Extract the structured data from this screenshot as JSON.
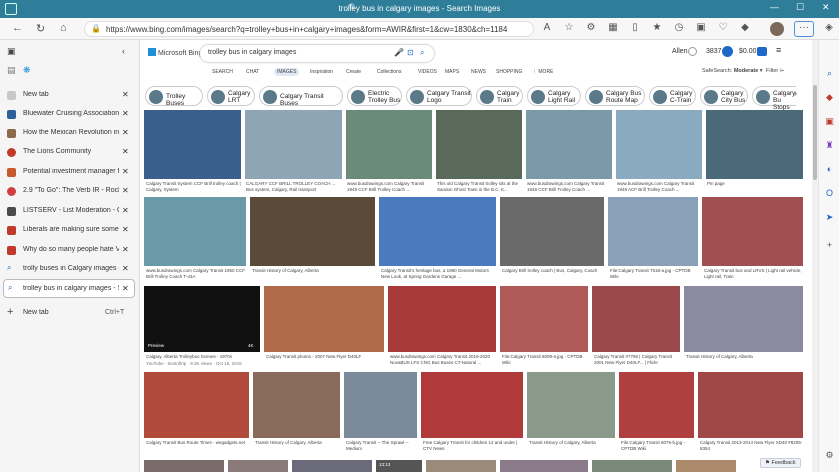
{
  "window": {
    "title": "trolley bus in calgary images - Search Images",
    "controls": [
      "—",
      "☐",
      "✕"
    ]
  },
  "browser": {
    "url": "https://www.bing.com/images/search?q=trolley+bus+in+calgary+images&form=AWIR&first=1&cw=1830&ch=1184",
    "toolbar_rewards_count": "3837",
    "toolbar_money": "$0.00"
  },
  "tabs_panel": {
    "tabs": [
      {
        "label": "New tab",
        "color": "#c8c8c8"
      },
      {
        "label": "Bluewater Cruising Association",
        "color": "#2f5f9a"
      },
      {
        "label": "How the Mexican Revolution inspired",
        "color": "#8a6a4a"
      },
      {
        "label": "The Lions Community",
        "color": "#c0392b"
      },
      {
        "label": "Potential investment manager for",
        "color": "#c75a2a"
      },
      {
        "label": "2.9 \"To Go\": The Verb IR - Rocket",
        "color": "#d04040"
      },
      {
        "label": "LISTSERV - List Moderation - CCI",
        "color": "#4a4a4a"
      },
      {
        "label": "Liberals are making sure some of",
        "color": "#c0392b"
      },
      {
        "label": "Why do so many people hate VAT",
        "color": "#c0392b"
      },
      {
        "label": "trolly buses in Calgary images - S",
        "color": "#1e68c8"
      },
      {
        "label": "trolley bus in calgary images - Se",
        "color": "#1e68c8"
      }
    ],
    "new_tab_label": "New tab",
    "new_tab_shortcut": "Ctrl+T"
  },
  "bing": {
    "logo_text": "Microsoft Bing",
    "query": "trolley bus in calgary images",
    "user_name": "Allen",
    "rewards": "3837",
    "money": "$0.00",
    "nav_tabs": [
      "SEARCH",
      "CHAT",
      "IMAGES",
      "Inspiration",
      "Create",
      "Collections",
      "VIDEOS",
      "MAPS",
      "NEWS",
      "SHOPPING",
      "⋮ MORE"
    ],
    "safesearch_label": "SafeSearch:",
    "safesearch_value": "Moderate",
    "filter_label": "Filter",
    "related_chips": [
      {
        "line1": "Trolley Buses",
        "line2": ""
      },
      {
        "line1": "Calgary",
        "line2": "LRT"
      },
      {
        "line1": "Calgary Transit Buses",
        "line2": ""
      },
      {
        "line1": "Electric",
        "line2": "Trolley Bus"
      },
      {
        "line1": "Calgary Transit",
        "line2": "Logo"
      },
      {
        "line1": "Calgary",
        "line2": "Train"
      },
      {
        "line1": "Calgary",
        "line2": "Light Rail"
      },
      {
        "line1": "Calgary Bus",
        "line2": "Route Map"
      },
      {
        "line1": "Calgary",
        "line2": "C-Train"
      },
      {
        "line1": "Calgary",
        "line2": "City Bus"
      },
      {
        "line1": "Calgary Bu",
        "line2": "Stops"
      }
    ],
    "results": [
      {
        "caption": "Calgary Transit System CCF Brill trolley coach | Calgary, System",
        "color": "#3a5f8c"
      },
      {
        "caption": "CALGARY CCF BRILL TROLLEY COACH ... Bus system, Calgary, Rail transport",
        "color": "#8ea5b5"
      },
      {
        "caption": "www.busdrawings.com Calgary Transit 1949 CCF Brill Trolley Coach ...",
        "color": "#6a8a7a"
      },
      {
        "caption": "This old Calgary Transit trolley sits at the Sandon Ghost Town in the B.C. K...",
        "color": "#5a6a5a"
      },
      {
        "caption": "www.busdrawings.com Calgary Transit 1948 CCF Brill Trolley Coach ...",
        "color": "#7a9aaa"
      },
      {
        "caption": "www.busdrawings.com Calgary Transit 1948 ACF Brill Trolley Coach ...",
        "color": "#8aaac0"
      },
      {
        "caption": "Pin page",
        "color": "#4a6a7a"
      },
      {
        "caption": "www.busdrawings.com Calgary Transit 1950 CCF Brill Trolley Coach T-43A",
        "color": "#6a9aa8"
      },
      {
        "caption": "Transit History of Calgary, Alberta",
        "color": "#5a4a3a"
      },
      {
        "caption": "Calgary Transit's heritage bus, a 1980 General Motors New Look, at Spring Gardens Garage ...",
        "color": "#4a7ac0"
      },
      {
        "caption": "Calgary Brill trolley coach | Bus, Calgary, Coach",
        "color": "#6a6a6a"
      },
      {
        "caption": "File:Calgary Transit 7518-a.jpg - CPTDB Wiki",
        "color": "#8aa0b8"
      },
      {
        "caption": "Calgary Transit bus and LRVS | Light rail vehicle, Light rail, Train",
        "color": "#a05050"
      },
      {
        "caption": "Calgary, Alberta Trolleybus Scenes - 1970s",
        "color": "#111111"
      },
      {
        "caption": "Calgary Transit photos - 2007 New Flyer D40LF",
        "color": "#b06a4a"
      },
      {
        "caption": "www.busdrawings.com Calgary Transit 2019-2020 NovaBUS LFS CNG Bus Buses CT-Natural ...",
        "color": "#a83a3a"
      },
      {
        "caption": "File:Calgary Transit 6009-a.jpg - CPTDB Wiki",
        "color": "#b05a5a"
      },
      {
        "caption": "Calgary Transit #7766 | Calgary Transit 2001 New Flyer D40LF... | Flickr",
        "color": "#9a4a4a"
      },
      {
        "caption": "Transit History of Calgary, Alberta",
        "color": "#8a8aa0"
      },
      {
        "caption": "Calgary Transit Bus Route Times - wegadgets.net",
        "color": "#b04a3a"
      },
      {
        "caption": "Transit History of Calgary, Alberta",
        "color": "#8a6a5a"
      },
      {
        "caption": "Calgary Transit -- The Sprawl -- Medium",
        "color": "#7a8a9a"
      },
      {
        "caption": "Free Calgary Transit for children 12 and under | CTV News",
        "color": "#b03a3a"
      },
      {
        "caption": "Transit History of Calgary, Alberta",
        "color": "#8a9a8a"
      },
      {
        "caption": "File:Calgary Transit 6075-b.jpg - CPTDB Wiki",
        "color": "#b04040"
      },
      {
        "caption": "Calgary Transit 2013-2014 New Flyer XD40 #8205-8354",
        "color": "#a04848"
      }
    ],
    "video_meta": "YouTube · bestoftrip · 9.3K views · Oct 15, 2016",
    "video_preview_label": "Preview",
    "video_duration": "4K",
    "feedback_label": "Feedback",
    "bottom_time": "13:13"
  }
}
